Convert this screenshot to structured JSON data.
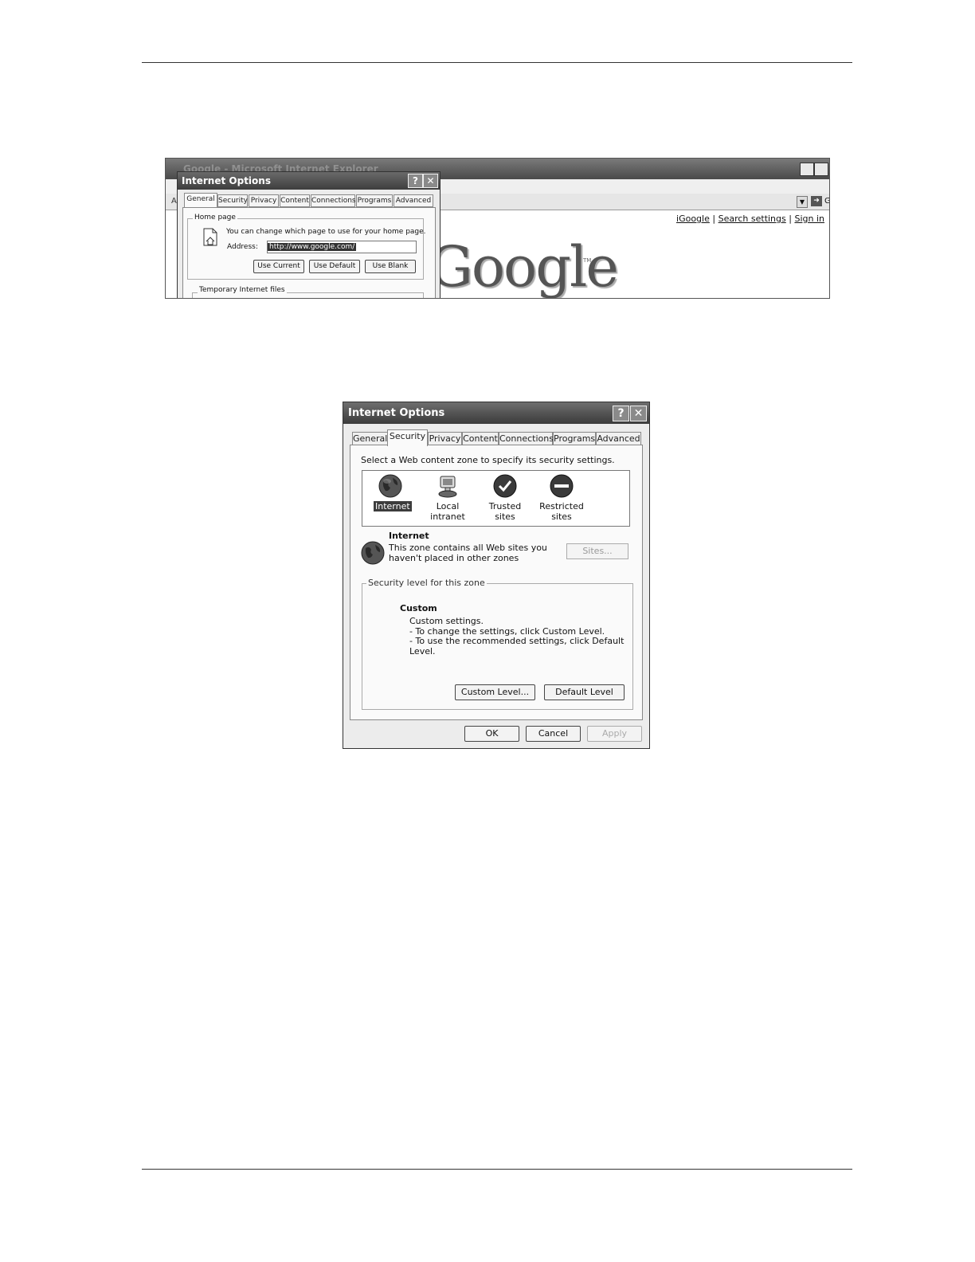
{
  "screenshot1": {
    "browser_title": "Google - Microsoft Internet Explorer",
    "address_letter": "A",
    "go_letter": "G",
    "links": [
      "iGoogle",
      "Search settings",
      "Sign in"
    ],
    "link_separator": "|",
    "logo_text": "Google",
    "logo_tm": "TM",
    "dialog": {
      "title": "Internet Options",
      "help_btn": "?",
      "close_btn": "✕",
      "tabs": [
        "General",
        "Security",
        "Privacy",
        "Content",
        "Connections",
        "Programs",
        "Advanced"
      ],
      "selected_tab": "General",
      "home_group_label": "Home page",
      "home_desc": "You can change which page to use for your home page.",
      "address_label": "Address:",
      "address_value": "http://www.google.com/",
      "buttons": [
        "Use Current",
        "Use Default",
        "Use Blank"
      ],
      "temp_group_label": "Temporary Internet files"
    }
  },
  "dialog2": {
    "title": "Internet Options",
    "help_btn": "?",
    "close_btn": "✕",
    "tabs": [
      "General",
      "Security",
      "Privacy",
      "Content",
      "Connections",
      "Programs",
      "Advanced"
    ],
    "selected_tab": "Security",
    "instruction": "Select a Web content zone to specify its security settings.",
    "zones": [
      {
        "label": "Internet",
        "icon": "globe-icon",
        "selected": true
      },
      {
        "label": "Local intranet",
        "icon": "computer-icon",
        "selected": false
      },
      {
        "label": "Trusted sites",
        "icon": "checkmark-icon",
        "selected": false
      },
      {
        "label": "Restricted sites",
        "icon": "restricted-icon",
        "selected": false
      }
    ],
    "zone_name": "Internet",
    "zone_desc_line1": "This zone contains all Web sites you",
    "zone_desc_line2": "haven't placed in other zones",
    "sites_button": "Sites...",
    "security_group_label": "Security level for this zone",
    "level_name": "Custom",
    "level_line1": "Custom settings.",
    "level_line2": "- To change the settings, click Custom Level.",
    "level_line3": "- To use the recommended settings, click Default Level.",
    "custom_level_button": "Custom Level...",
    "default_level_button": "Default Level",
    "ok_button": "OK",
    "cancel_button": "Cancel",
    "apply_button": "Apply"
  }
}
